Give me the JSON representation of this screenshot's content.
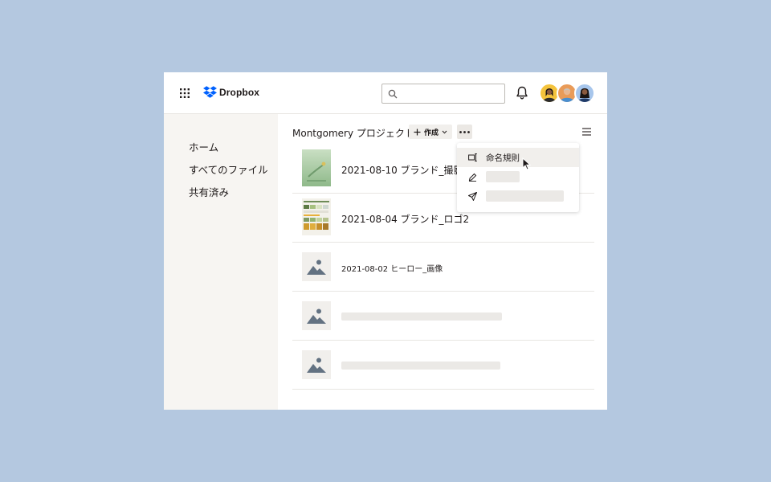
{
  "app": {
    "brand": "Dropbox",
    "brand_color": "#0061fe"
  },
  "header": {
    "search": {
      "placeholder": "",
      "icon": "search-icon"
    },
    "notifications_icon": "bell-icon",
    "avatars": [
      "avatar-yellow",
      "avatar-orange",
      "avatar-blue"
    ]
  },
  "sidebar": {
    "items": [
      {
        "label": "ホーム"
      },
      {
        "label": "すべてのファイル"
      },
      {
        "label": "共有済み"
      }
    ]
  },
  "folder": {
    "title": "Montgomery プロジェクト",
    "create_label": "作成",
    "more_icon": "ellipsis-icon",
    "view_icon": "list-view-icon"
  },
  "files": [
    {
      "name": "2021-08-10 ブランド_撮影",
      "thumbnail": "photo"
    },
    {
      "name": "2021-08-04 ブランド_ロゴ2",
      "thumbnail": "palette"
    },
    {
      "name": "2021-08-02 ヒーロー_画像",
      "thumbnail": "image-placeholder"
    },
    {
      "name": "",
      "thumbnail": "image-placeholder"
    },
    {
      "name": "",
      "thumbnail": "image-placeholder"
    }
  ],
  "menu": {
    "items": [
      {
        "label": "命名規則",
        "icon": "naming-convention-icon"
      },
      {
        "label": "",
        "icon": "rename-pencil-icon"
      },
      {
        "label": "",
        "icon": "send-icon"
      }
    ]
  },
  "colors": {
    "background": "#b4c8e0",
    "sidebar": "#f7f5f2",
    "text": "#1e1919"
  }
}
